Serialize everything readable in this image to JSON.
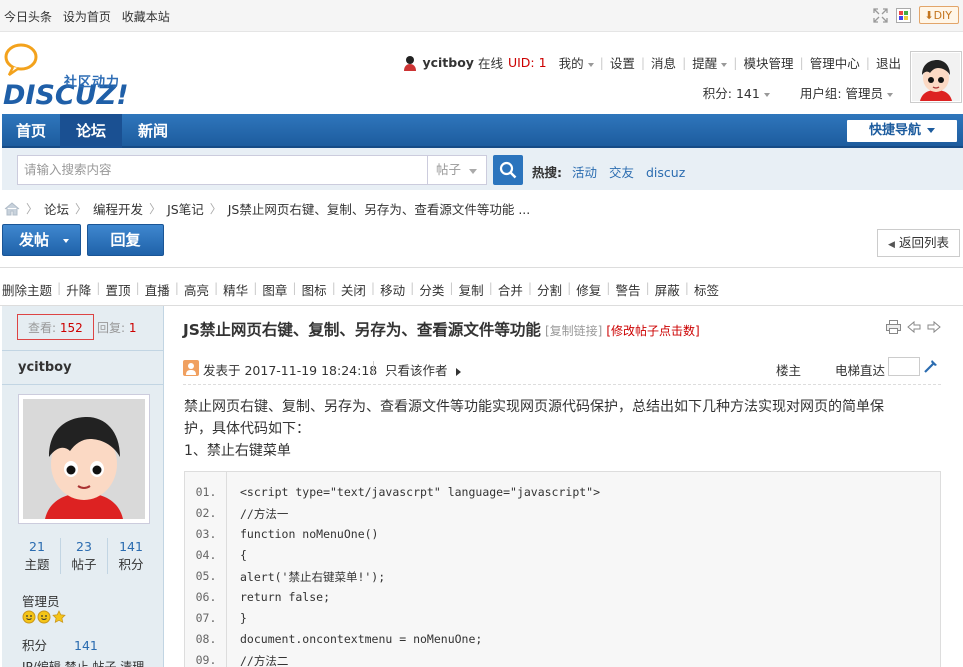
{
  "topbar": {
    "links": [
      "今日头条",
      "设为首页",
      "收藏本站"
    ],
    "diy_label": "DIY"
  },
  "logo": {
    "slogan": "社区动力",
    "brand": "DISCUZ!"
  },
  "user": {
    "name": "ycitboy",
    "online": "在线",
    "uid": "UID: 1",
    "menu": [
      "我的",
      "设置",
      "消息",
      "提醒",
      "模块管理",
      "管理中心",
      "退出"
    ],
    "score": "积分: 141",
    "group": "用户组: 管理员"
  },
  "nav": {
    "items": [
      "首页",
      "论坛",
      "新闻"
    ],
    "active": "论坛",
    "quicknav": "快捷导航"
  },
  "search": {
    "placeholder": "请输入搜索内容",
    "type": "帖子",
    "hot_label": "热搜:",
    "hot_items": [
      "活动",
      "交友",
      "discuz"
    ]
  },
  "breadcrumb": [
    "论坛",
    "编程开发",
    "JS笔记",
    "JS禁止网页右键、复制、另存为、查看源文件等功能 ..."
  ],
  "actions": {
    "post": "发帖",
    "reply": "回复",
    "back": "返回列表"
  },
  "mod_tools": [
    "删除主题",
    "升降",
    "置顶",
    "直播",
    "高亮",
    "精华",
    "图章",
    "图标",
    "关闭",
    "移动",
    "分类",
    "复制",
    "合并",
    "分割",
    "修复",
    "警告",
    "屏蔽",
    "标签"
  ],
  "thread": {
    "views_label": "查看:",
    "views": "152",
    "replies_label": "回复:",
    "replies": "1",
    "title": "JS禁止网页右键、复制、另存为、查看源文件等功能",
    "copy_link": "[复制链接]",
    "modify_clicks": "[修改帖子点击数]"
  },
  "author": {
    "name": "ycitboy",
    "stats": [
      {
        "value": "21",
        "label": "主题"
      },
      {
        "value": "23",
        "label": "帖子"
      },
      {
        "value": "141",
        "label": "积分"
      }
    ],
    "group": "管理员",
    "score_label": "积分",
    "score": "141",
    "more": "IP/编辑 禁止 帖子 清理"
  },
  "post": {
    "posted": "发表于 2017-11-19 18:24:18",
    "only_author": "只看该作者",
    "floor": "楼主",
    "goto": "电梯直达",
    "body_line1": "禁止网页右键、复制、另存为、查看源文件等功能实现网页源代码保护，总结出如下几种方法实现对网页的简单保",
    "body_line2": "护，具体代码如下：",
    "body_line3": "1、禁止右键菜单"
  },
  "code": [
    {
      "n": "01.",
      "t": "<script type=\"text/javascrpt\" language=\"javascript\">"
    },
    {
      "n": "02.",
      "t": "//方法一"
    },
    {
      "n": "03.",
      "t": "function noMenuOne()"
    },
    {
      "n": "04.",
      "t": "{"
    },
    {
      "n": "05.",
      "t": "alert('禁止右键菜单!');"
    },
    {
      "n": "06.",
      "t": "return false;"
    },
    {
      "n": "07.",
      "t": "}"
    },
    {
      "n": "08.",
      "t": "document.oncontextmenu = noMenuOne;"
    },
    {
      "n": "09.",
      "t": "//方法二"
    }
  ],
  "colors": {
    "nav": "#1d5c9e",
    "link": "#2b6cb0",
    "alert": "#cc0000",
    "sidebar": "#e5edf2"
  }
}
